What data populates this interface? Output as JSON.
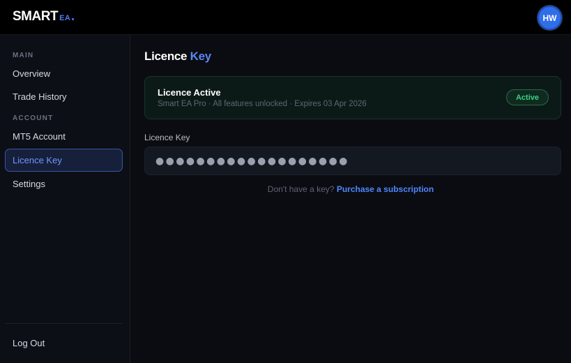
{
  "brand": {
    "name": "SMART",
    "suffix": "EA"
  },
  "user": {
    "initials": "HW"
  },
  "sidebar": {
    "sections": [
      {
        "label": "MAIN"
      },
      {
        "label": "ACCOUNT"
      }
    ],
    "items": [
      {
        "label": "Overview",
        "active": false
      },
      {
        "label": "Trade History",
        "active": false
      },
      {
        "label": "MT5 Account",
        "active": false
      },
      {
        "label": "Licence Key",
        "active": true
      },
      {
        "label": "Settings",
        "active": false
      }
    ],
    "logout_label": "Log Out"
  },
  "page": {
    "title_part1": "Licence",
    "title_part2": "Key"
  },
  "status": {
    "title": "Licence Active",
    "subtitle": "Smart EA Pro · All features unlocked · Expires 03 Apr 2026",
    "badge": "Active"
  },
  "licence_field": {
    "label": "Licence Key",
    "value": "●●●●●●●●●●●●●●●●●●●"
  },
  "helper": {
    "text": "Don't have a key?",
    "link_text": "Purchase a subscription"
  },
  "colors": {
    "accent": "#4f86ff",
    "active_green": "#3ecf86",
    "background": "#0b0c11"
  }
}
